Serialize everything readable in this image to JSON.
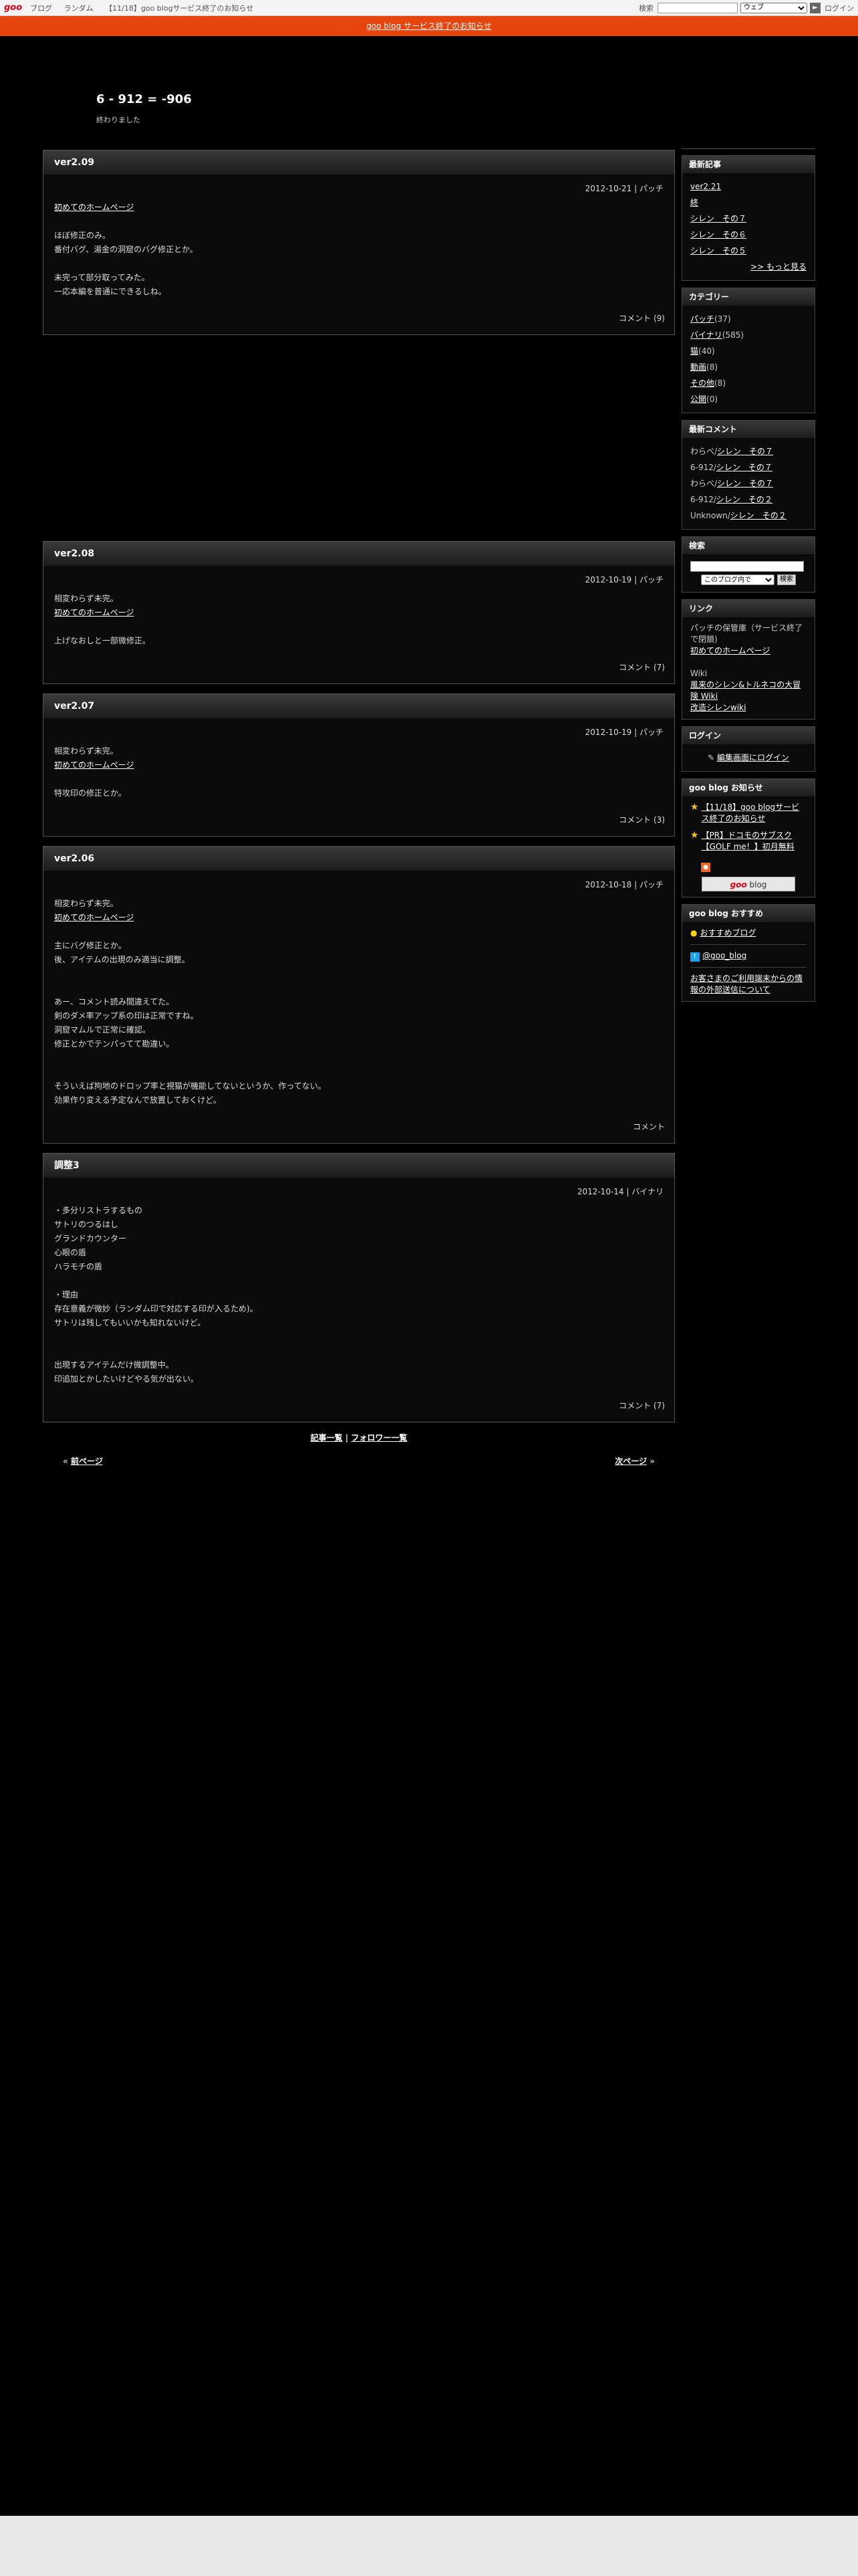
{
  "goo_bar": {
    "logo": "goo",
    "nav": [
      "ブログ",
      "ランダム",
      "【11/18】goo blogサービス終了のお知らせ"
    ],
    "search_label": "検索",
    "search_select": "ウェブ",
    "login": "ログイン"
  },
  "notice": "goo blog サービス終了のお知らせ",
  "blog": {
    "title": "6 - 912 = -906",
    "description": "終わりました"
  },
  "entries": [
    {
      "title": "ver2.09",
      "date": "2012-10-21",
      "category": "パッチ",
      "link": "初めてのホームページ",
      "lines": [
        "",
        "ほぼ修正のみ。",
        "番付バグ、湯金の洞窟のバグ修正とか。",
        "",
        "未完って部分取ってみた。",
        "一応本編を普通にできるしね。"
      ],
      "comment": "コメント (9)"
    },
    {
      "title": "ver2.08",
      "date": "2012-10-19",
      "category": "パッチ",
      "pre": "相変わらず未完。",
      "link": "初めてのホームページ",
      "lines": [
        "",
        "上げなおしと一部微修正。"
      ],
      "comment": "コメント (7)"
    },
    {
      "title": "ver2.07",
      "date": "2012-10-19",
      "category": "パッチ",
      "pre": "相変わらず未完。",
      "link": "初めてのホームページ",
      "lines": [
        "",
        "特攻印の修正とか。"
      ],
      "comment": "コメント (3)"
    },
    {
      "title": "ver2.06",
      "date": "2012-10-18",
      "category": "パッチ",
      "pre": "相変わらず未完。",
      "link": "初めてのホームページ",
      "lines": [
        "",
        "主にバグ修正とか。",
        "後、アイテムの出現のみ適当に調整。",
        "",
        "",
        "あー、コメント読み間違えてた。",
        "剣のダメ率アップ系の印は正常ですね。",
        "洞窟マムルで正常に確認。",
        "修正とかでテンパってて勘違い。",
        "",
        "",
        "そういえば拘地のドロップ率と視猫が機能してないというか、作ってない。",
        "効果作り変える予定なんで放置しておくけど。"
      ],
      "comment": "コメント"
    },
    {
      "title": "調整3",
      "date": "2012-10-14",
      "category": "バイナリ",
      "lines": [
        "・多分リストラするもの",
        "サトリのつるはし",
        "グランドカウンター",
        "心眼の盾",
        "ハラモチの盾",
        "",
        "・理由",
        "存在意義が微妙（ランダム印で対応する印が入るため)。",
        "サトリは残してもいいかも知れないけど。",
        "",
        "",
        "出現するアイテムだけ微調整中。",
        "印追加とかしたいけどやる気が出ない。"
      ],
      "comment": "コメント (7)"
    }
  ],
  "list_links": {
    "articles": "記事一覧",
    "sep": "|",
    "followers": "フォロワー一覧"
  },
  "pager": {
    "prev_mark": "«",
    "prev": "前ページ",
    "next": "次ページ",
    "next_mark": "»"
  },
  "sidebar": {
    "recent": {
      "heading": "最新記事",
      "items": [
        "ver2.21",
        "終",
        "シレン　その７",
        "シレン　その６",
        "シレン　その５"
      ],
      "more": ">> もっと見る"
    },
    "categories": {
      "heading": "カテゴリー",
      "items": [
        {
          "name": "パッチ",
          "count": "(37)"
        },
        {
          "name": "バイナリ",
          "count": "(585)"
        },
        {
          "name": "猫",
          "count": "(40)"
        },
        {
          "name": "動画",
          "count": "(8)"
        },
        {
          "name": "その他",
          "count": "(8)"
        },
        {
          "name": "公開",
          "count": "(0)"
        }
      ]
    },
    "comments": {
      "heading": "最新コメント",
      "items": [
        {
          "who": "わらべ/",
          "post": "シレン　その７"
        },
        {
          "who": "6-912/",
          "post": "シレン　その７"
        },
        {
          "who": "わらべ/",
          "post": "シレン　その７"
        },
        {
          "who": "6-912/",
          "post": "シレン　その２"
        },
        {
          "who": "Unknown/",
          "post": "シレン　その２"
        }
      ]
    },
    "search": {
      "heading": "検索",
      "select": "このブログ内で",
      "button": "検索"
    },
    "links": {
      "heading": "リンク",
      "text1": "パッチの保管庫（サービス終了で閉鎖)",
      "link1": "初めてのホームページ",
      "label2": "Wiki",
      "link2": "風来のシレン&トルネコの大冒険 Wiki",
      "link3": "改造シレンwiki"
    },
    "login": {
      "heading": "ログイン",
      "link": "編集画面にログイン"
    },
    "goo_notice": {
      "heading": "goo blog お知らせ",
      "items": [
        "【11/18】goo blogサービス終了のお知らせ",
        "【PR】ドコモのサブスク【GOLF me！】初月無料"
      ],
      "button_brand": "goo",
      "button_text": " blog"
    },
    "recommend": {
      "heading": "goo blog おすすめ",
      "item": "おすすめブログ",
      "twitter": "@goo_blog",
      "info": "お客さまのご利用端末からの情報の外部送信について"
    }
  }
}
